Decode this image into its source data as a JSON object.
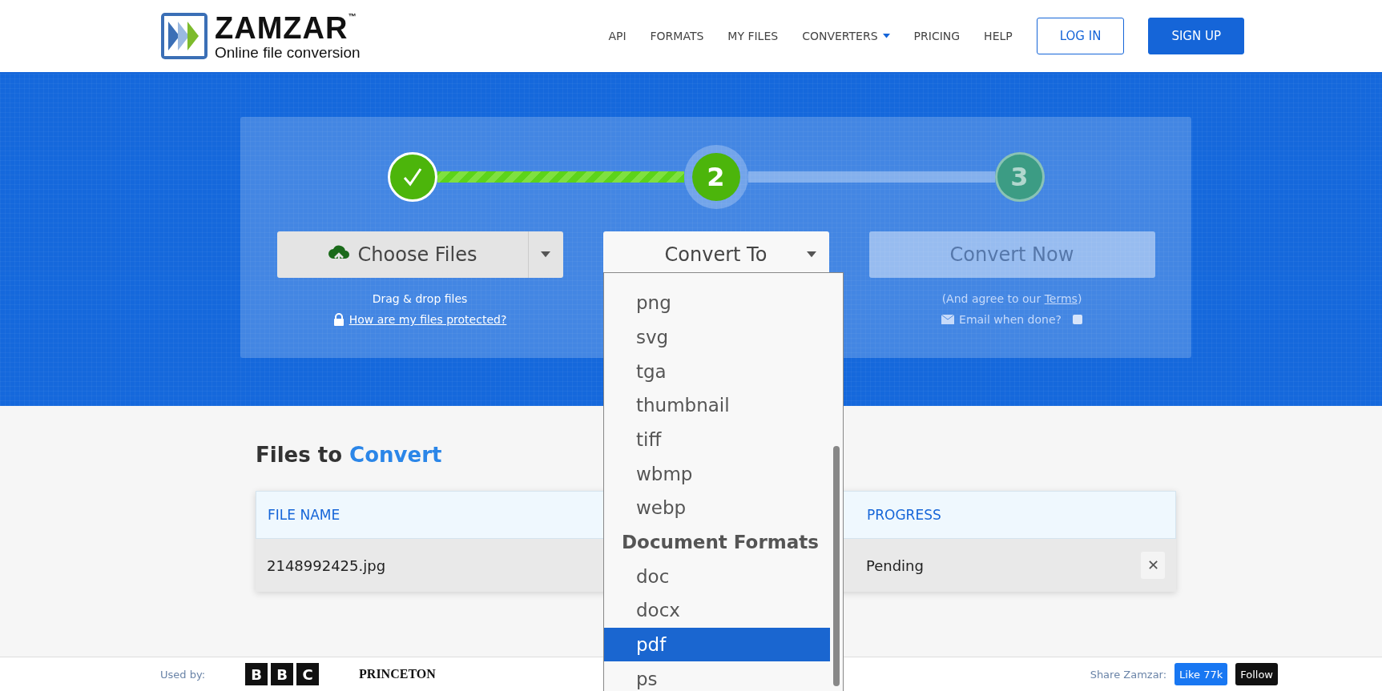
{
  "header": {
    "logo": {
      "name": "ZAMZAR",
      "trademark": "™",
      "tagline": "Online file conversion"
    },
    "nav": [
      {
        "label": "API",
        "dropdown": false
      },
      {
        "label": "FORMATS",
        "dropdown": false
      },
      {
        "label": "MY FILES",
        "dropdown": false
      },
      {
        "label": "CONVERTERS",
        "dropdown": true
      },
      {
        "label": "PRICING",
        "dropdown": false
      },
      {
        "label": "HELP",
        "dropdown": false
      }
    ],
    "buttons": [
      {
        "label": "LOG IN",
        "kind": "outline"
      },
      {
        "label": "SIGN UP",
        "kind": "solid"
      }
    ]
  },
  "steps": [
    {
      "kind": "done"
    },
    {
      "kind": "active",
      "number": "2",
      "level": 1
    },
    {
      "kind": "pending",
      "number": "3",
      "level": 0
    }
  ],
  "choose": {
    "label": "Choose Files",
    "hint": "Drag & drop files",
    "protect_link": "How are my files protected?"
  },
  "convert_to": {
    "label": "Convert To",
    "expanded": true,
    "options": [
      {
        "kind": "option",
        "label": "png",
        "selected": false
      },
      {
        "kind": "option",
        "label": "svg",
        "selected": false
      },
      {
        "kind": "option",
        "label": "tga",
        "selected": false
      },
      {
        "kind": "option",
        "label": "thumbnail",
        "selected": false
      },
      {
        "kind": "option",
        "label": "tiff",
        "selected": false
      },
      {
        "kind": "option",
        "label": "wbmp",
        "selected": false
      },
      {
        "kind": "option",
        "label": "webp",
        "selected": false
      },
      {
        "kind": "group",
        "label": "Document Formats"
      },
      {
        "kind": "option",
        "label": "doc",
        "selected": false
      },
      {
        "kind": "option",
        "label": "docx",
        "selected": false
      },
      {
        "kind": "option",
        "label": "pdf",
        "selected": true
      },
      {
        "kind": "option",
        "label": "ps",
        "selected": false
      }
    ]
  },
  "convert_now": {
    "label": "Convert Now",
    "disabled": true,
    "agree_text": "(And agree to our ",
    "terms_link": "Terms",
    "agree_end": ")",
    "email_label": "Email when done?",
    "email_checked": false
  },
  "files": {
    "title_start": "Files to ",
    "title_accent": "Convert",
    "columns": [
      "FILE NAME",
      "PROGRESS"
    ],
    "rows": [
      {
        "file_name": "2148992425.jpg",
        "progress": "Pending",
        "remove": "✕"
      }
    ]
  },
  "footer": {
    "used_by": "Used by:",
    "logos": [
      {
        "kind": "bbc",
        "letters": [
          "B",
          "B",
          "C"
        ]
      },
      {
        "kind": "princeton",
        "label": "PRINCETON"
      }
    ],
    "share": "Share Zamzar:",
    "like": "Like 77k",
    "follow": "Follow"
  }
}
